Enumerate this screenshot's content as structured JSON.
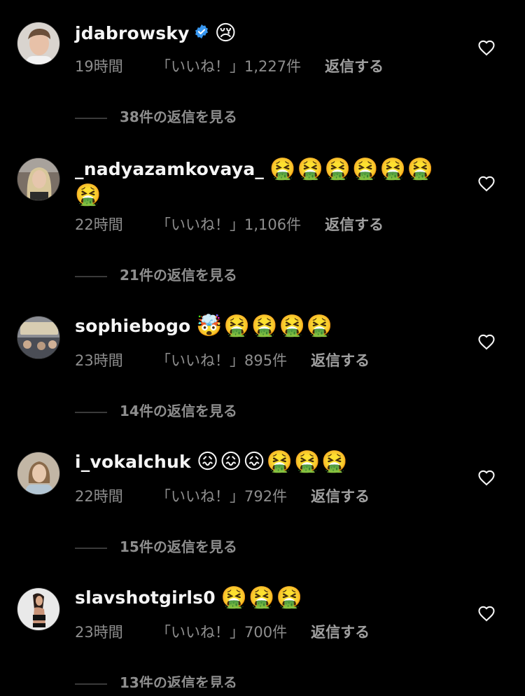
{
  "comments": [
    {
      "username": "jdabrowsky",
      "verified": true,
      "emojis": "😢",
      "time": "19時間",
      "likes": "「いいね！」1,227件",
      "reply": "返信する",
      "view_replies": "38件の返信を見る"
    },
    {
      "username": "_nadyazamkovaya_",
      "verified": false,
      "emojis": "🤮🤮🤮🤮🤮🤮",
      "emojis2": "🤮",
      "time": "22時間",
      "likes": "「いいね！」1,106件",
      "reply": "返信する",
      "view_replies": "21件の返信を見る"
    },
    {
      "username": "sophiebogo",
      "verified": false,
      "emojis": "🤯🤮🤮🤮🤮",
      "time": "23時間",
      "likes": "「いいね！」895件",
      "reply": "返信する",
      "view_replies": "14件の返信を見る"
    },
    {
      "username": "i_vokalchuk",
      "verified": false,
      "emojis": "😖😖😖🤮🤮🤮",
      "time": "22時間",
      "likes": "「いいね！」792件",
      "reply": "返信する",
      "view_replies": "15件の返信を見る"
    },
    {
      "username": "slavshotgirls0",
      "verified": false,
      "emojis": "🤮🤮🤮",
      "time": "23時間",
      "likes": "「いいね！」700件",
      "reply": "返信する",
      "view_replies": "13件の返信を見る"
    }
  ],
  "colors": {
    "background": "#000000",
    "text": "#f5f5f5",
    "secondary_text": "#8e8e8e",
    "verified_badge": "#3897f0"
  }
}
